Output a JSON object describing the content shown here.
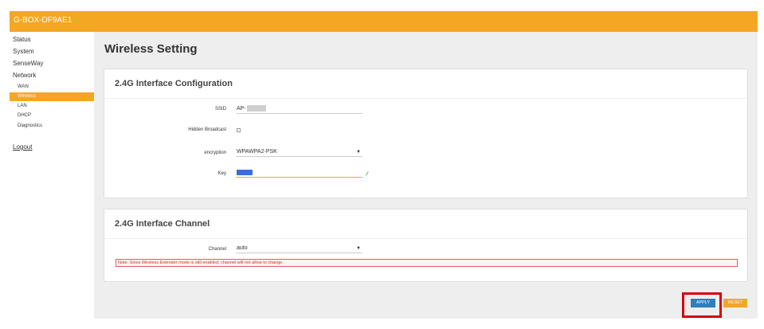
{
  "header": {
    "brand": "G-BOX-DF9AE1"
  },
  "sidebar": {
    "items": [
      {
        "label": "Status"
      },
      {
        "label": "System"
      },
      {
        "label": "SenseWay"
      },
      {
        "label": "Network"
      }
    ],
    "network_subitems": [
      {
        "label": "WAN",
        "active": false
      },
      {
        "label": "Wireless",
        "active": true
      },
      {
        "label": "LAN",
        "active": false
      },
      {
        "label": "DHCP",
        "active": false
      },
      {
        "label": "Diagnostics",
        "active": false
      }
    ],
    "logout": "Logout"
  },
  "main": {
    "title": "Wireless Setting",
    "interface_config": {
      "title": "2.4G Interface Configuration",
      "ssid_label": "SSID",
      "ssid_value": "AP-",
      "hidden_broadcast_label": "Hidden Broadcast",
      "hidden_broadcast_checked": false,
      "encryption_label": "encryption",
      "encryption_value": "WPAWPA2-PSK",
      "key_label": "Key"
    },
    "interface_channel": {
      "title": "2.4G Interface Channel",
      "channel_label": "Channel",
      "channel_value": "auto",
      "note": "Note: Since Wireless Extender mode is still enabled, channel will not allow to change."
    },
    "buttons": {
      "apply": "APPLY",
      "reset": "RESET"
    }
  },
  "colors": {
    "accent": "#f5a623",
    "apply": "#2f7fbe",
    "highlight": "#d6000f",
    "note_text": "#d32f2f"
  },
  "icons": {
    "select_arrow": "chevron-down-icon",
    "eye": "eye-icon"
  }
}
